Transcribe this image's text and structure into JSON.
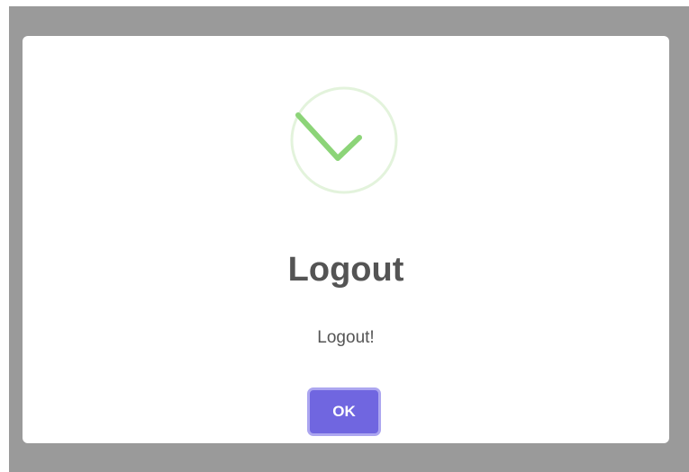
{
  "dialog": {
    "icon": "success-check-icon",
    "title": "Logout",
    "message": "Logout!",
    "confirm_label": "OK"
  },
  "colors": {
    "backdrop": "#9a9a9a",
    "dialog_background": "#ffffff",
    "success_ring": "#e3f3dc",
    "success_check": "#8cd478",
    "title_text": "#545454",
    "confirm_button": "#7066e0",
    "confirm_button_focus_ring": "#aca6f0"
  }
}
